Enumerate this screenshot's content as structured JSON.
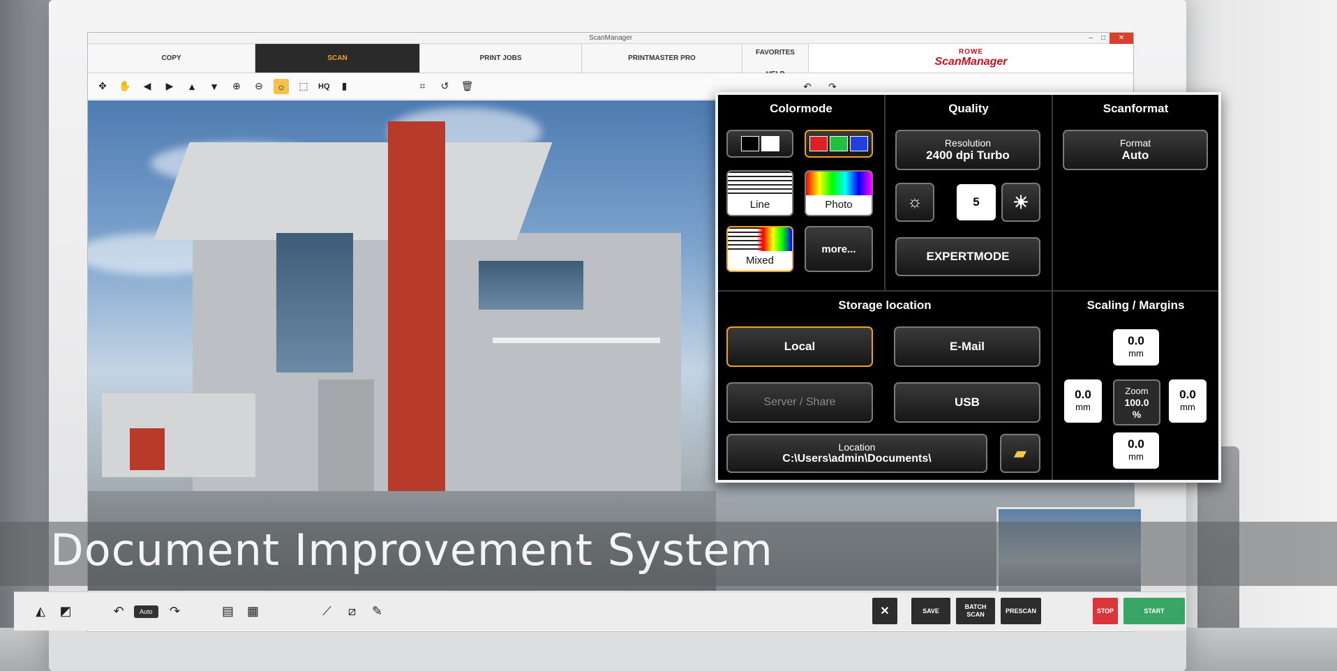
{
  "window": {
    "title": "ScanManager",
    "minimize": "–",
    "maximize": "□",
    "close": "✕"
  },
  "tabs": [
    {
      "label": "COPY"
    },
    {
      "label": "SCAN"
    },
    {
      "label": "PRINT JOBS"
    },
    {
      "label": "PRINTMASTER PRO"
    },
    {
      "label": "FAVORITES"
    },
    {
      "label": "HELP"
    }
  ],
  "logo": {
    "brand": "ROWE",
    "product": "ScanManager"
  },
  "toolbar": {
    "hq_label": "HQ"
  },
  "caption": "Document Improvement System",
  "bottom": {
    "auto_label": "Auto",
    "save_label": "SAVE",
    "batch_scan_label": "BATCH\nSCAN",
    "prescan_label": "PRESCAN",
    "stop_label": "STOP",
    "start_label": "START"
  },
  "colors": {
    "accent": "#f0a020",
    "stop": "#d9353a",
    "start": "#3aa666",
    "panel_bg": "#000000"
  },
  "panel": {
    "colormode": {
      "title": "Colormode",
      "line_label": "Line",
      "photo_label": "Photo",
      "mixed_label": "Mixed",
      "more_label": "more..."
    },
    "quality": {
      "title": "Quality",
      "resolution_label": "Resolution",
      "resolution_value": "2400 dpi Turbo",
      "brightness_value": "5",
      "expertmode_label": "EXPERTMODE"
    },
    "scanformat": {
      "title": "Scanformat",
      "format_label": "Format",
      "format_value": "Auto"
    },
    "storage": {
      "title": "Storage location",
      "local_label": "Local",
      "email_label": "E-Mail",
      "server_label": "Server / Share",
      "usb_label": "USB",
      "location_label": "Location",
      "location_value": "C:\\Users\\admin\\Documents\\"
    },
    "scaling": {
      "title": "Scaling / Margins",
      "top_value": "0.0",
      "top_unit": "mm",
      "left_value": "0.0",
      "left_unit": "mm",
      "right_value": "0.0",
      "right_unit": "mm",
      "bottom_value": "0.0",
      "bottom_unit": "mm",
      "zoom_label": "Zoom",
      "zoom_value": "100.0",
      "zoom_unit": "%"
    }
  }
}
